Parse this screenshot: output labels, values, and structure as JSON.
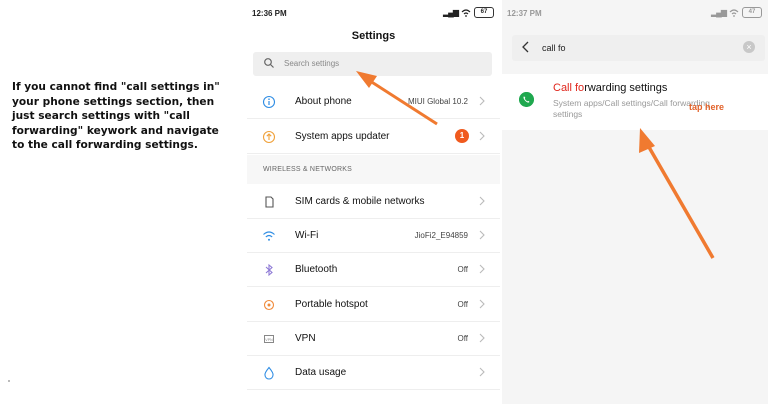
{
  "instructions": {
    "lines": [
      "If you cannot find \"call settings in\"",
      "your phone settings section, then",
      "just search settings with \"call",
      "forwarding\" keywork and navigate",
      "to the call forwarding settings."
    ]
  },
  "phone1": {
    "status_time": "12:36 PM",
    "battery": "67",
    "title": "Settings",
    "search_placeholder": "Search settings",
    "rows": [
      {
        "label": "About phone",
        "value": "MIUI Global 10.2",
        "icon": "info-icon"
      },
      {
        "label": "System apps updater",
        "badge": "1",
        "icon": "upload-icon"
      },
      {
        "label": "SIM cards & mobile networks",
        "icon": "sim-icon"
      },
      {
        "label": "Wi-Fi",
        "value": "JioFi2_E94859",
        "icon": "wifi-icon"
      },
      {
        "label": "Bluetooth",
        "value": "Off",
        "icon": "bluetooth-icon"
      },
      {
        "label": "Portable hotspot",
        "value": "Off",
        "icon": "hotspot-icon"
      },
      {
        "label": "VPN",
        "value": "Off",
        "icon": "vpn-icon"
      },
      {
        "label": "Data usage",
        "icon": "data-drop-icon"
      }
    ],
    "section_header": "WIRELESS & NETWORKS"
  },
  "phone2": {
    "status_time": "12:37 PM",
    "search_query": "call fo",
    "result": {
      "title_highlight": "Call fo",
      "title_rest": "rwarding settings",
      "subtitle": "System apps/Call settings/Call forwarding settings"
    },
    "annotation": "tap here"
  },
  "colors": {
    "arrow": "#f07a30",
    "badge": "#f05a1e",
    "highlight": "#e0251b",
    "phone_icon_green": "#1fa84f",
    "info_blue": "#2f8de4"
  }
}
